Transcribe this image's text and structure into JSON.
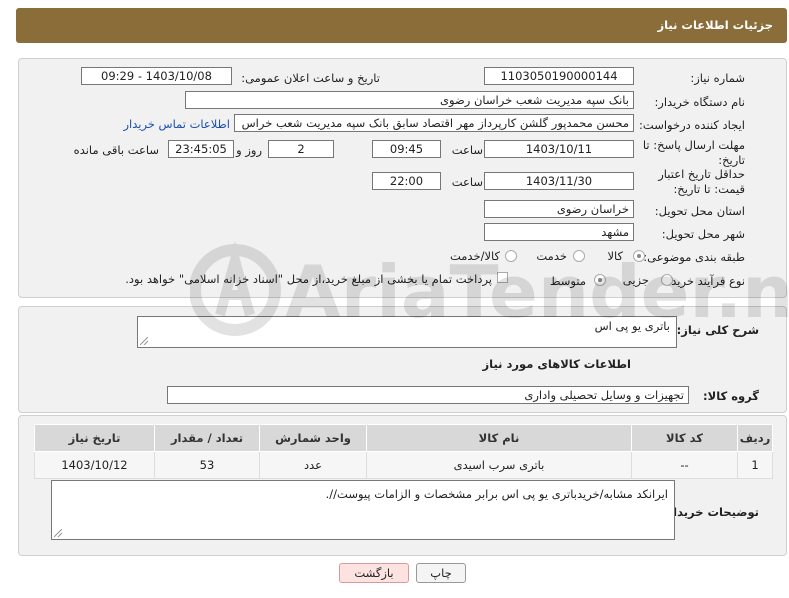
{
  "header": {
    "title": "جزئیات اطلاعات نیاز"
  },
  "form": {
    "need_number": {
      "label": "شماره نیاز:",
      "value": "1103050190000144"
    },
    "announce": {
      "label": "تاریخ و ساعت اعلان عمومی:",
      "value": "1403/10/08 - 09:29"
    },
    "buyer": {
      "label": "نام دستگاه خریدار:",
      "value": "بانک سپه مدیریت شعب خراسان رضوی"
    },
    "creator": {
      "label": "ایجاد کننده درخواست:",
      "value": "محسن محمدپور گلشن کارپرداز مهر اقتصاد سابق بانک سپه مدیریت شعب خراس",
      "contact_link": "اطلاعات تماس خریدار"
    },
    "deadline": {
      "label": "مهلت ارسال پاسخ: تا تاریخ:",
      "date": "1403/10/11",
      "time_label": "ساعت",
      "time": "09:45",
      "days": "2",
      "days_label": "روز و",
      "remaining": "23:45:05",
      "remaining_label": "ساعت باقی مانده"
    },
    "validity": {
      "label": "حداقل تاریخ اعتبار قیمت: تا تاریخ:",
      "date": "1403/11/30",
      "time_label": "ساعت",
      "time": "22:00"
    },
    "province": {
      "label": "استان محل تحویل:",
      "value": "خراسان رضوی"
    },
    "city": {
      "label": "شهر محل تحویل:",
      "value": "مشهد"
    },
    "category": {
      "label": "طبقه بندی موضوعی:",
      "options": [
        "کالا",
        "خدمت",
        "کالا/خدمت"
      ]
    },
    "process": {
      "label": "نوع فرآیند خرید :",
      "options": [
        "جزیی",
        "متوسط"
      ],
      "payment_note": "پرداخت تمام یا بخشی از مبلغ خرید،از محل \"اسناد خزانه اسلامی\" خواهد بود."
    }
  },
  "description": {
    "label": "شرح کلی نیاز:",
    "value": "باتری یو پی اس"
  },
  "goods_info": {
    "title": "اطلاعات کالاهای مورد نیاز"
  },
  "goods_group": {
    "label": "گروه کالا:",
    "value": "تجهیزات و وسایل تحصیلی واداری"
  },
  "table": {
    "headers": [
      "ردیف",
      "کد کالا",
      "نام کالا",
      "واحد شمارش",
      "تعداد / مقدار",
      "تاریخ نیاز"
    ],
    "rows": [
      [
        "1",
        "--",
        "باتری سرب اسیدی",
        "عدد",
        "53",
        "1403/10/12"
      ]
    ]
  },
  "buyer_notes": {
    "label": "توضیحات خریدار:",
    "value": "ایرانکد مشابه/خریدباتری یو پی اس برابر مشخصات و الزامات پیوست//."
  },
  "buttons": {
    "print": "چاپ",
    "back": "بازگشت"
  },
  "watermark": "AriaTender.neT",
  "colors": {
    "header_bg": "#8b6d3a",
    "link": "#1a4fb0",
    "back_button_bg": "#fde2e2"
  }
}
